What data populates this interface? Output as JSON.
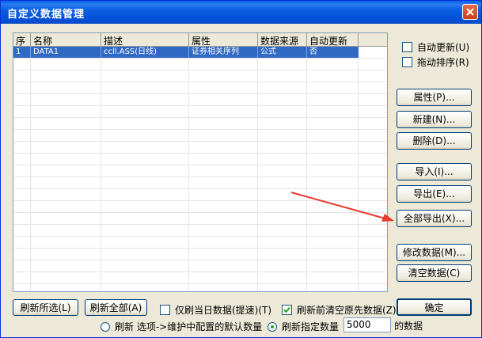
{
  "window": {
    "title": "自定义数据管理"
  },
  "grid": {
    "columns": [
      "序",
      "名称",
      "描述",
      "属性",
      "数据来源",
      "自动更新"
    ],
    "rows": [
      [
        "1",
        "DATA1",
        "ccll.ASS(日线)",
        "证券相关序列",
        "公式",
        "否"
      ]
    ]
  },
  "right_panel": {
    "auto_update_label": "自动更新(U)",
    "drag_sort_label": "拖动排序(R)",
    "props_button": "属性(P)...",
    "new_button": "新建(N)...",
    "delete_button": "删除(D)...",
    "import_button": "导入(I)...",
    "export_button": "导出(E)...",
    "export_all_button": "全部导出(X)...",
    "modify_data_button": "修改数据(M)...",
    "clear_data_button": "清空数据(C)",
    "ok_button": "确定"
  },
  "bottom": {
    "refresh_selected_button": "刷新所选(L)",
    "refresh_all_button": "刷新全部(A)",
    "today_only_label": "仅刷当日数据(提速)(T)",
    "clear_before_refresh_label": "刷新前清空原先数据(Z)",
    "radio_default_label": "刷新 选项->维护中配置的默认数量",
    "radio_specified_label": "刷新指定数量",
    "count_value": "5000",
    "count_suffix": "的数据"
  },
  "state": {
    "auto_update_checked": false,
    "drag_sort_checked": false,
    "today_only_checked": false,
    "clear_before_refresh_checked": true,
    "radio_selected": "specified"
  },
  "colors": {
    "title_bar": "#0a5fe8",
    "selection": "#316ac5",
    "annotation_arrow": "#e83a2e"
  }
}
